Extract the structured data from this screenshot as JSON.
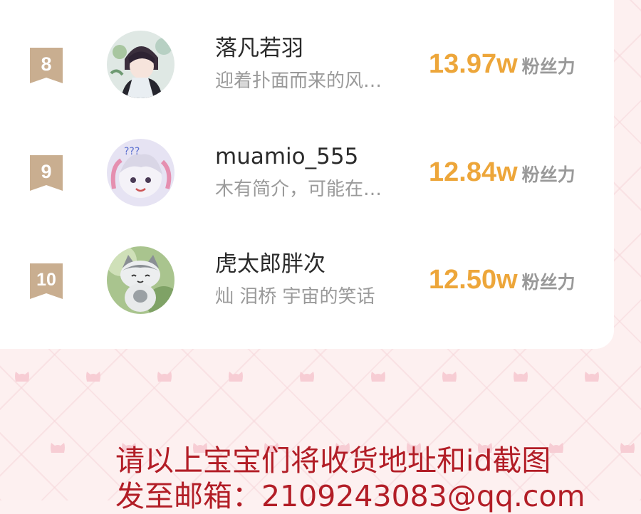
{
  "leaderboard": {
    "entries": [
      {
        "rank": "8",
        "name": "落凡若羽",
        "bio": "迎着扑面而来的风…",
        "fans_value": "13.97w",
        "fans_label": "粉丝力",
        "avatar": "anime-boy-avatar"
      },
      {
        "rank": "9",
        "name": "muamio_555",
        "bio": "木有简介，可能在…",
        "fans_value": "12.84w",
        "fans_label": "粉丝力",
        "avatar": "chibi-character-avatar"
      },
      {
        "rank": "10",
        "name": "虎太郎胖次",
        "bio": "灿 泪桥 宇宙的笑话",
        "fans_value": "12.50w",
        "fans_label": "粉丝力",
        "avatar": "gray-cat-plush-avatar"
      }
    ]
  },
  "notice": {
    "line1": "请以上宝宝们将收货地址和id截图",
    "line2": "发至邮箱：2109243083@qq.com"
  },
  "colors": {
    "badge": "#c9ae90",
    "fans_accent": "#eda63a",
    "notice_text": "#b21d26",
    "background_pink": "#fdf0f0"
  },
  "icons": [
    "rank-ribbon-icon",
    "cat-head-icon"
  ]
}
